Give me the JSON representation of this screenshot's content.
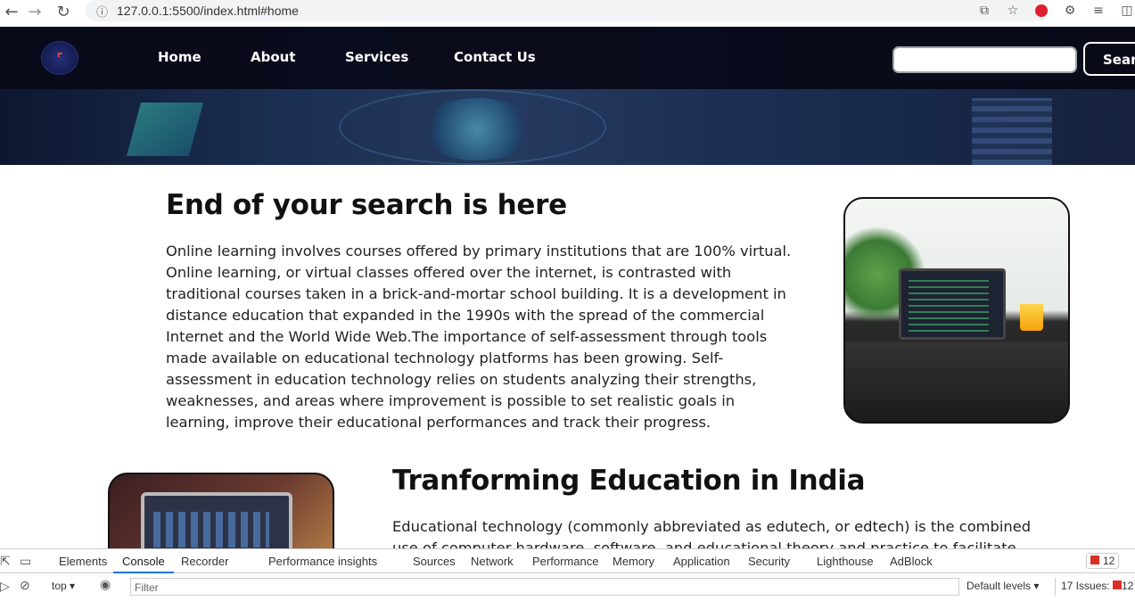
{
  "browser": {
    "url": "127.0.0.1:5500/index.html#home",
    "icons": [
      "back-icon",
      "forward-icon",
      "reload-icon",
      "info-icon",
      "share-icon",
      "star-icon",
      "opera-icon",
      "extensions-icon",
      "reading-list-icon",
      "sidepanel-icon"
    ]
  },
  "navbar": {
    "logo_text": "",
    "links": [
      "Home",
      "About",
      "Services",
      "Contact Us"
    ],
    "search_placeholder": "",
    "search_button": "Search"
  },
  "section1": {
    "title": "End of your search is here",
    "text": "Online learning involves courses offered by primary institutions that are 100% virtual. Online learning, or virtual classes offered over the internet, is contrasted with traditional courses taken in a brick-and-mortar school building. It is a development in distance education that expanded in the 1990s with the spread of the commercial Internet and the World Wide Web.The importance of self-assessment through tools made available on educational technology platforms has been growing. Self-assessment in education technology relies on students analyzing their strengths, weaknesses, and areas where improvement is possible to set realistic goals in learning, improve their educational performances and track their progress."
  },
  "section2": {
    "title": "Tranforming Education in India",
    "text": "Educational technology (commonly abbreviated as edutech, or edtech) is the combined use of computer hardware, software, and educational theory and practice to facilitate learning."
  },
  "devtools": {
    "tabs": [
      "Elements",
      "Console",
      "Recorder",
      "Performance insights",
      "Sources",
      "Network",
      "Performance",
      "Memory",
      "Application",
      "Security",
      "Lighthouse",
      "AdBlock"
    ],
    "active_tab": "Console",
    "error_count": "12",
    "context": "top",
    "filter_placeholder": "Filter",
    "levels": "Default levels",
    "issues": "17 Issues:",
    "issues_count": "12"
  },
  "colors": {
    "navbar_bg": "#080a18",
    "accent_blue": "#1a73e8",
    "error_red": "#d93025"
  }
}
